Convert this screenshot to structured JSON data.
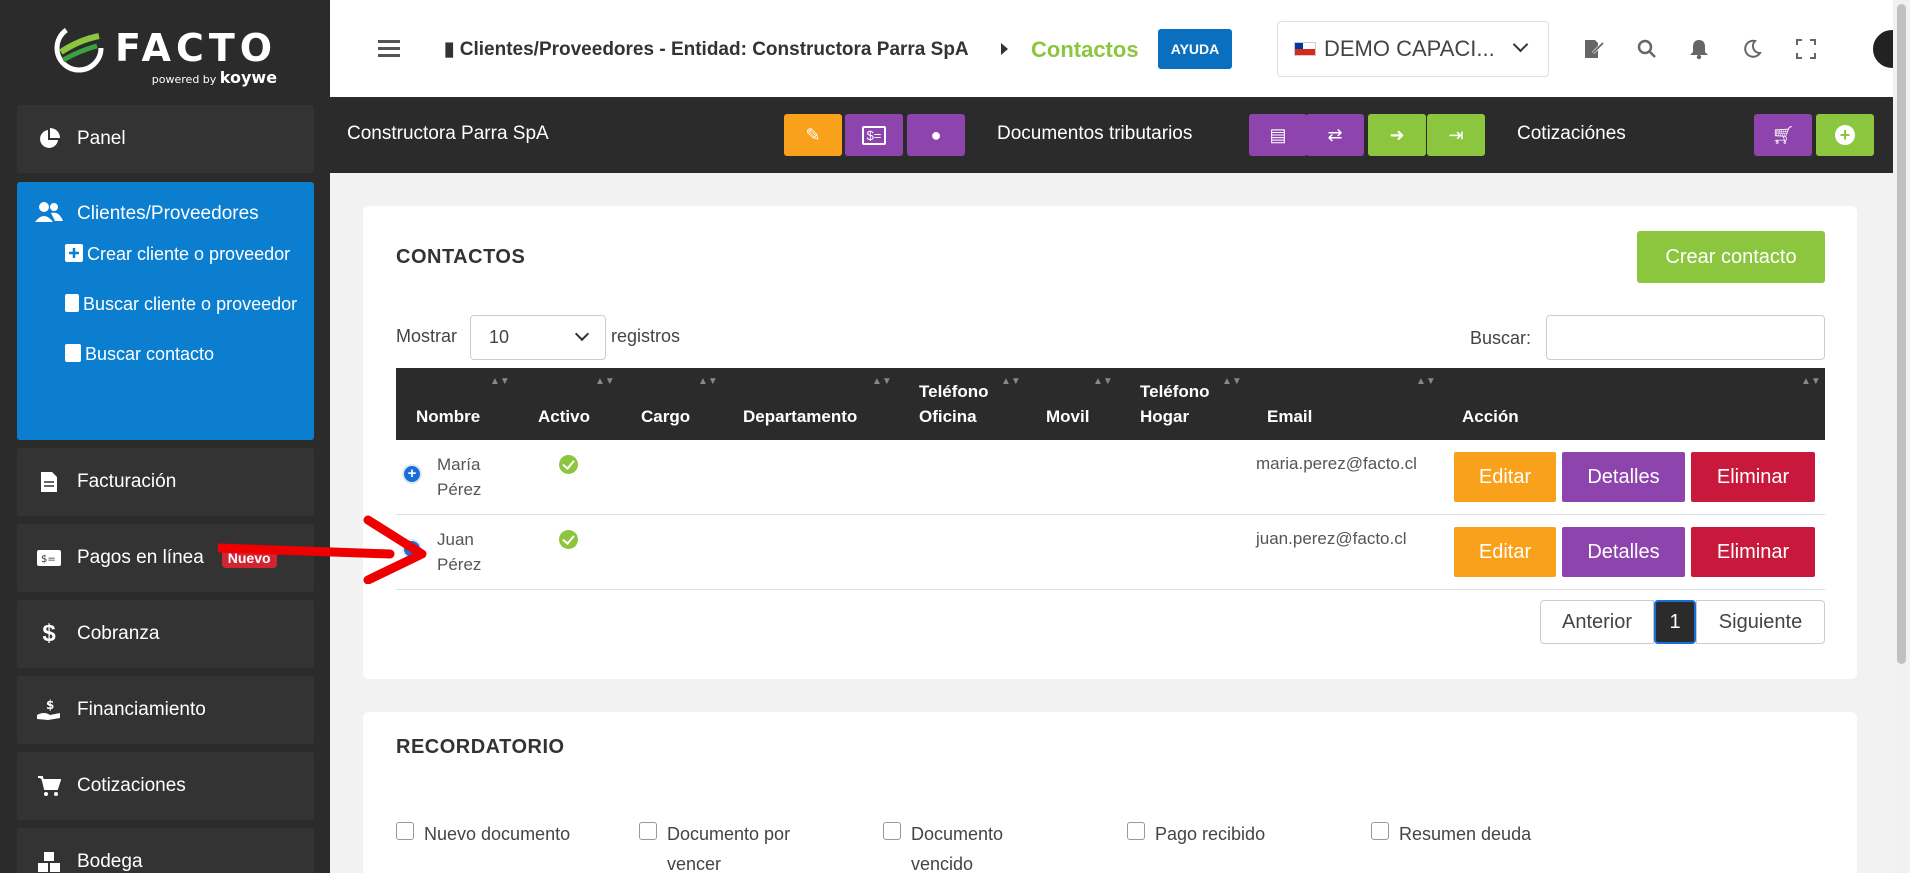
{
  "brand": {
    "name": "FACTO",
    "powered": "powered by",
    "partner": "koywe"
  },
  "sidebar": {
    "panel": "Panel",
    "clients": {
      "label": "Clientes/Proveedores",
      "sub": [
        "Crear cliente o proveedor",
        "Buscar cliente o proveedor",
        "Buscar contacto"
      ]
    },
    "billing": "Facturación",
    "payments": "Pagos en línea",
    "payments_badge": "Nuevo",
    "collections": "Cobranza",
    "financing": "Financiamiento",
    "quotes": "Cotizaciones",
    "warehouse": "Bodega"
  },
  "topbar": {
    "breadcrumb": "Clientes/Proveedores - Entidad: Constructora Parra SpA",
    "current": "Contactos",
    "help": "AYUDA",
    "company": "DEMO CAPACI..."
  },
  "subheader": {
    "entity": "Constructora Parra SpA",
    "tax_docs": "Documentos tributarios",
    "quotes": "Cotizaciónes"
  },
  "contacts": {
    "title": "CONTACTOS",
    "create": "Crear contacto",
    "show": "Mostrar",
    "page_size": "10",
    "records": "registros",
    "search": "Buscar:",
    "headers": [
      "Nombre",
      "Activo",
      "Cargo",
      "Departamento",
      "Teléfono Oficina",
      "Movil",
      "Teléfono Hogar",
      "Email",
      "Acción"
    ],
    "header_lines": {
      "office_1": "Teléfono",
      "office_2": "Oficina",
      "home_1": "Teléfono",
      "home_2": "Hogar"
    },
    "rows": [
      {
        "first": "María",
        "last": "Pérez",
        "email": "maria.perez@facto.cl"
      },
      {
        "first": "Juan",
        "last": "Pérez",
        "email": "juan.perez@facto.cl"
      }
    ],
    "actions": {
      "edit": "Editar",
      "details": "Detalles",
      "delete": "Eliminar"
    },
    "pager": {
      "prev": "Anterior",
      "page": "1",
      "next": "Siguiente"
    }
  },
  "reminder": {
    "title": "RECORDATORIO",
    "options": [
      {
        "l1": "Nuevo documento",
        "l2": ""
      },
      {
        "l1": "Documento por",
        "l2": "vencer"
      },
      {
        "l1": "Documento",
        "l2": "vencido"
      },
      {
        "l1": "Pago recibido",
        "l2": ""
      },
      {
        "l1": "Resumen deuda",
        "l2": ""
      }
    ]
  },
  "colors": {
    "accent_blue": "#0b7ed0",
    "green": "#8cc63f",
    "orange": "#f9a11b",
    "purple": "#8e44ad",
    "red": "#c8193c",
    "dark": "#2b2b2b"
  }
}
